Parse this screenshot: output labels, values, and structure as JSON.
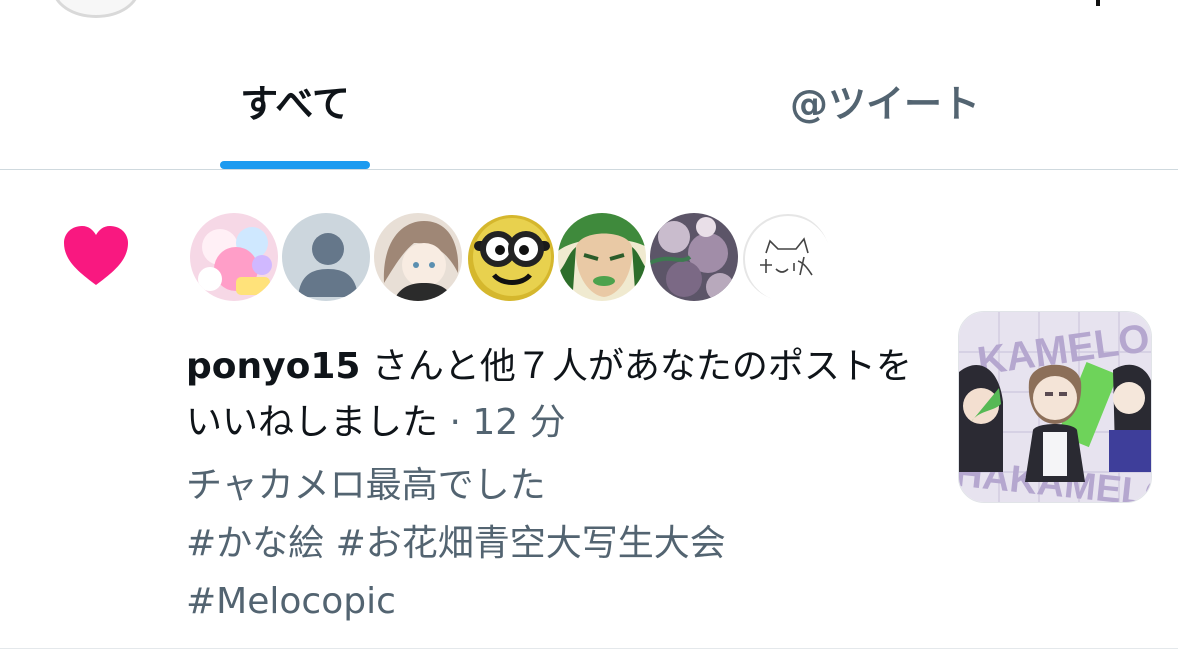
{
  "tabs": [
    {
      "label": "すべて",
      "active": true
    },
    {
      "label": "@ツイート",
      "active": false
    }
  ],
  "colors": {
    "accent": "#1d9bf0",
    "like": "#f91880",
    "primary_text": "#0f1419",
    "secondary_text": "#536471"
  },
  "notification": {
    "icon": "heart-icon",
    "username": "ponyo15",
    "message": "さんと他７人があなたのポストをいいねしました",
    "separator": "·",
    "time": "12 分",
    "tweet_lines": [
      "チャカメロ最高でした",
      "#かな絵 #お花畑青空大写生大会",
      "#Melocopic"
    ],
    "thumbnail_text": [
      "KAMELO",
      "HAKAMELO"
    ]
  }
}
